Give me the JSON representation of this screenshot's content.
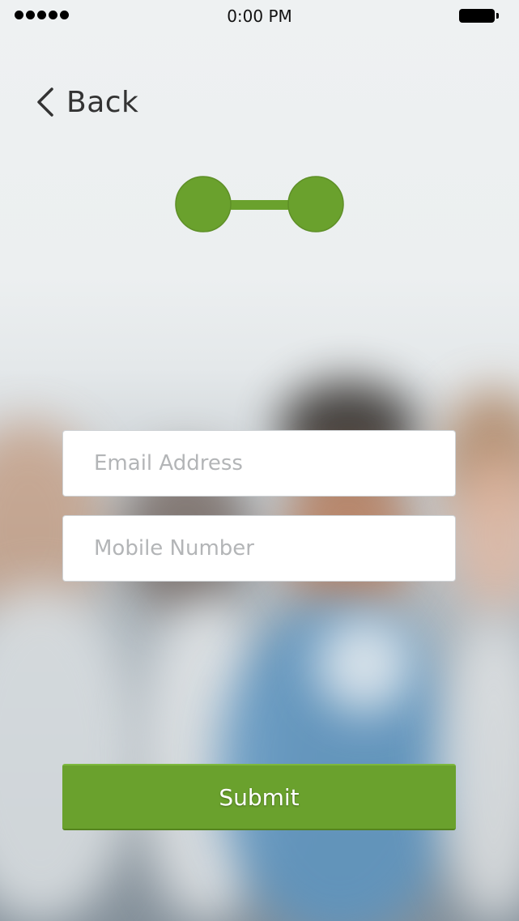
{
  "status_bar": {
    "time": "0:00 PM",
    "signal_dots": 5
  },
  "nav": {
    "back_label": "Back",
    "back_icon": "chevron-left-icon"
  },
  "step_indicator": {
    "steps": 2,
    "color": "#6aa12d"
  },
  "form": {
    "email_placeholder": "Email Address",
    "mobile_placeholder": "Mobile Number",
    "submit_label": "Submit"
  },
  "colors": {
    "accent": "#6aa12d",
    "text": "#333333",
    "placeholder": "#b3b5b7"
  }
}
